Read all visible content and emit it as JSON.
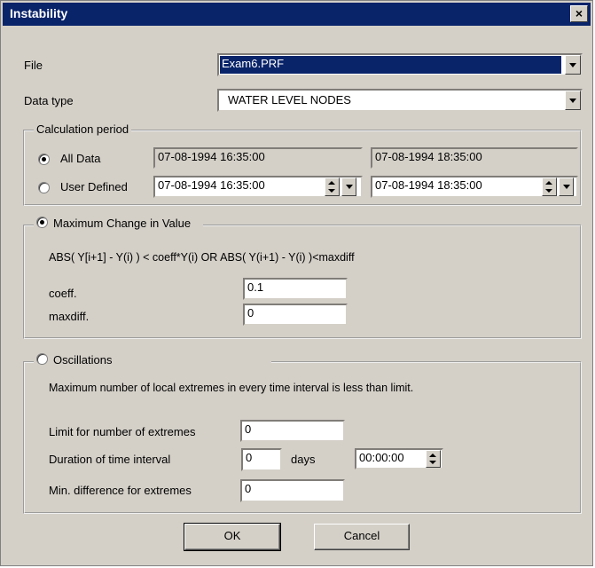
{
  "window": {
    "title": "Instability",
    "close_label": "×"
  },
  "file": {
    "label": "File",
    "value": "Exam6.PRF"
  },
  "data_type": {
    "label": "Data type",
    "value": "WATER LEVEL  NODES"
  },
  "calc_period": {
    "legend": "Calculation period",
    "all_data": {
      "label": "All Data",
      "checked": true,
      "start": "07-08-1994 16:35:00",
      "end": "07-08-1994 18:35:00"
    },
    "user_defined": {
      "label": "User Defined",
      "checked": false,
      "start": "07-08-1994 16:35:00",
      "end": "07-08-1994 18:35:00"
    }
  },
  "max_change": {
    "label": "Maximum Change in Value",
    "checked": true,
    "formula": "ABS( Y[i+1] - Y(i) ) < coeff*Y(i)  OR  ABS( Y(i+1) - Y(i) )<maxdiff",
    "coeff_label": "coeff.",
    "coeff_value": "0.1",
    "maxdiff_label": "maxdiff.",
    "maxdiff_value": "0"
  },
  "oscillations": {
    "label": "Oscillations",
    "checked": false,
    "description": "Maximum number of local extremes in every time interval is less than limit.",
    "limit_label": "Limit for number of extremes",
    "limit_value": "0",
    "duration_label": "Duration of time interval",
    "duration_days": "0",
    "days_label": "days",
    "duration_time": "00:00:00",
    "min_diff_label": "Min. difference for extremes",
    "min_diff_value": "0"
  },
  "buttons": {
    "ok": "OK",
    "cancel": "Cancel"
  }
}
